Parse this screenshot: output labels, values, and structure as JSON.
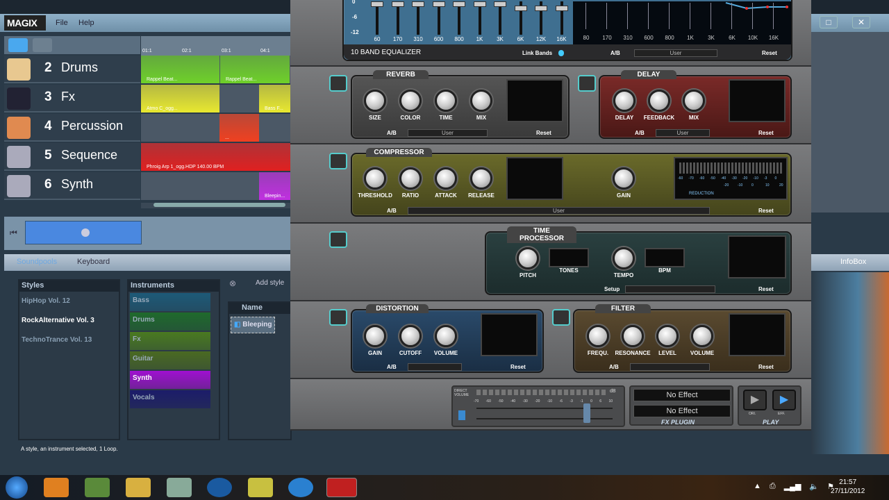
{
  "app": {
    "logo": "MAGIX",
    "menu": [
      "File",
      "Help"
    ],
    "window_buttons": [
      "□",
      "✕"
    ]
  },
  "ruler": [
    "01:1",
    "02:1",
    "03:1",
    "04:1"
  ],
  "tracks": [
    {
      "num": "2",
      "name": "Drums",
      "icon": "drum-icon",
      "color": "#6fd02a",
      "clips": [
        "Rappel Beat...",
        "Rappel Beat..."
      ]
    },
    {
      "num": "3",
      "name": "Fx",
      "icon": "soundfx-icon",
      "color": "#e8e830",
      "clips": [
        "Atmo C_ogg...",
        "Bass F..."
      ]
    },
    {
      "num": "4",
      "name": "Percussion",
      "icon": "conga-icon",
      "color": "#f04020",
      "clips": [
        "..."
      ]
    },
    {
      "num": "5",
      "name": "Sequence",
      "icon": "mixer-icon",
      "color": "#e02020",
      "clips": [
        "Phroig Arp 1_ogg.HDP  140.00 BPM"
      ]
    },
    {
      "num": "6",
      "name": "Synth",
      "icon": "mixer-icon",
      "color": "#c030e0",
      "clips": [
        "Bleepin..."
      ]
    }
  ],
  "tabs": [
    "Soundpools",
    "Keyboard"
  ],
  "infobox": "InfoBox",
  "styles": {
    "header": "Styles",
    "items": [
      "HipHop Vol. 12",
      "RockAlternative Vol. 3",
      "TechnoTrance Vol. 13"
    ],
    "selected": 1
  },
  "instruments": {
    "header": "Instruments",
    "items": [
      {
        "label": "Bass",
        "color": "#1d5a78"
      },
      {
        "label": "Drums",
        "color": "#1f6a2c"
      },
      {
        "label": "Fx",
        "color": "#4a7a20"
      },
      {
        "label": "Guitar",
        "color": "#4a6a22"
      },
      {
        "label": "Synth",
        "color": "#a010d0"
      },
      {
        "label": "Vocals",
        "color": "#1c1c6a"
      }
    ],
    "selected": 4
  },
  "loops": {
    "add_label": "Add style",
    "column": "Name",
    "items": [
      "Bleeping"
    ]
  },
  "status": "A style, an instrument selected, 1 Loop.",
  "eq": {
    "title": "10 BAND EQUALIZER",
    "link_bands": "Link Bands",
    "ab": "A/B",
    "preset": "User",
    "reset": "Reset",
    "scale": [
      "0",
      "-6",
      "-12"
    ],
    "bands": [
      "60",
      "170",
      "310",
      "600",
      "800",
      "1K",
      "3K",
      "6K",
      "12K",
      "16K"
    ],
    "graph_bands": [
      "80",
      "170",
      "310",
      "600",
      "800",
      "1K",
      "3K",
      "6K",
      "10K",
      "16K"
    ]
  },
  "reverb": {
    "title": "REVERB",
    "knobs": [
      "SIZE",
      "COLOR",
      "TIME",
      "MIX"
    ],
    "ab": "A/B",
    "preset": "User",
    "reset": "Reset"
  },
  "delay": {
    "title": "DELAY",
    "knobs": [
      "DELAY",
      "FEEDBACK",
      "MIX"
    ],
    "ab": "A/B",
    "preset": "User",
    "reset": "Reset"
  },
  "compressor": {
    "title": "COMPRESSOR",
    "knobs": [
      "THRESHOLD",
      "RATIO",
      "ATTACK",
      "RELEASE"
    ],
    "gain": "GAIN",
    "ab": "A/B",
    "preset": "User",
    "reset": "Reset",
    "meter_scale": [
      "-60",
      "-70",
      "-60",
      "-50",
      "-40",
      "-30",
      "-20",
      "-10",
      "-3",
      "0"
    ],
    "reduction_scale": [
      "-20",
      "-10",
      "0",
      "10",
      "20"
    ],
    "reduction": "REDUCTION"
  },
  "time_processor": {
    "title": "TIME PROCESSOR",
    "pitch": "PITCH",
    "tones": "TONES",
    "tempo": "TEMPO",
    "bpm": "BPM",
    "setup": "Setup",
    "reset": "Reset"
  },
  "distortion": {
    "title": "DISTORTION",
    "knobs": [
      "GAIN",
      "CUTOFF",
      "VOLUME"
    ],
    "ab": "A/B",
    "reset": "Reset"
  },
  "filter": {
    "title": "FILTER",
    "knobs": [
      "FREQU.",
      "RESONANCE",
      "LEVEL",
      "VOLUME"
    ],
    "ab": "A/B",
    "reset": "Reset"
  },
  "direct_volume": {
    "label": "DIRECT VOLUME",
    "unit": "dB",
    "scale": [
      "-70",
      "-60",
      "-50",
      "-40",
      "-30",
      "-20",
      "-10",
      "-6",
      "-3",
      "-1",
      "0",
      "6",
      "10"
    ],
    "value_db": 0
  },
  "fx_plugin": {
    "slots": [
      "No Effect",
      "No Effect"
    ],
    "label": "FX PLUGIN"
  },
  "play": {
    "label": "PLAY",
    "orig": "ORI.",
    "fx": "EFF.",
    "accent": "#4aa8ff"
  },
  "taskbar": {
    "time": "21:57",
    "date": "27/11/2012",
    "tray": [
      "▲",
      "⎙",
      "▂▄▆",
      "🔈",
      "⚑"
    ]
  }
}
